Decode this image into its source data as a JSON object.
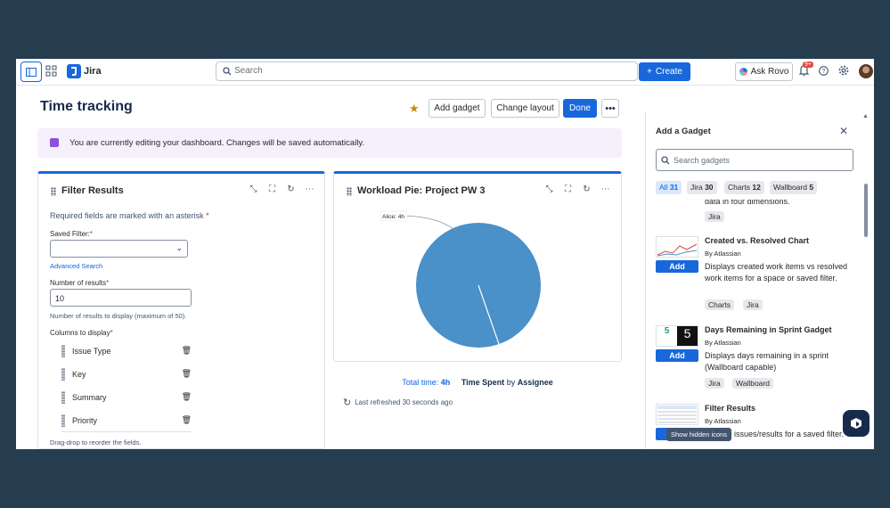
{
  "nav": {
    "app_name": "Jira",
    "search_placeholder": "Search",
    "create_label": "Create",
    "ask_rovo_label": "Ask Rovo",
    "notifications_badge": "9+"
  },
  "dashboard": {
    "title": "Time tracking",
    "add_gadget_label": "Add gadget",
    "change_layout_label": "Change layout",
    "done_label": "Done",
    "banner_text": "You are currently editing your dashboard. Changes will be saved automatically."
  },
  "filter_gadget": {
    "title": "Filter Results",
    "required_note": "Required fields are marked with an asterisk",
    "saved_filter_label": "Saved Filter:",
    "advanced_search_label": "Advanced Search",
    "number_label": "Number of results",
    "number_value": "10",
    "number_help": "Number of results to display (maximum of 50).",
    "columns_label": "Columns to display",
    "columns": [
      "Issue Type",
      "Key",
      "Summary",
      "Priority"
    ],
    "drag_help": "Drag-drop to reorder the fields."
  },
  "pie_gadget": {
    "title": "Workload Pie: Project PW 3",
    "slice_label": "Alice: 4h",
    "total_prefix": "Total time:",
    "total_value": "4h",
    "metric": "Time Spent",
    "by_word": "by",
    "group_by": "Assignee",
    "last_refreshed": "Last refreshed 30 seconds ago"
  },
  "chart_data": {
    "type": "pie",
    "categories": [
      "Alice"
    ],
    "values": [
      4
    ]
  },
  "panel": {
    "title": "Add a Gadget",
    "search_placeholder": "Search gadgets",
    "filters": [
      {
        "label": "All",
        "count": "31"
      },
      {
        "label": "Jira",
        "count": "30"
      },
      {
        "label": "Charts",
        "count": "12"
      },
      {
        "label": "Wallboard",
        "count": "5"
      }
    ],
    "partial_desc": "data in four dimensions.",
    "partial_tag": "Jira",
    "add_label": "Add",
    "gadgets": [
      {
        "name": "Created vs. Resolved Chart",
        "by": "By Atlassian",
        "desc": "Displays created work items vs resolved work items for a space or saved filter.",
        "tags": [
          "Charts",
          "Jira"
        ]
      },
      {
        "name": "Days Remaining in Sprint Gadget",
        "by": "By Atlassian",
        "desc": "Displays days remaining in a sprint (Wallboard capable)",
        "tags": [
          "Jira",
          "Wallboard"
        ]
      },
      {
        "name": "Filter Results",
        "by": "By Atlassian",
        "desc": "the issues/results for a saved filter.",
        "tags": []
      }
    ],
    "tooltip": "Show hidden icons",
    "thumb_days_value": "5"
  },
  "colors": {
    "brand": "#1868db",
    "pie": "#4a90c9"
  }
}
